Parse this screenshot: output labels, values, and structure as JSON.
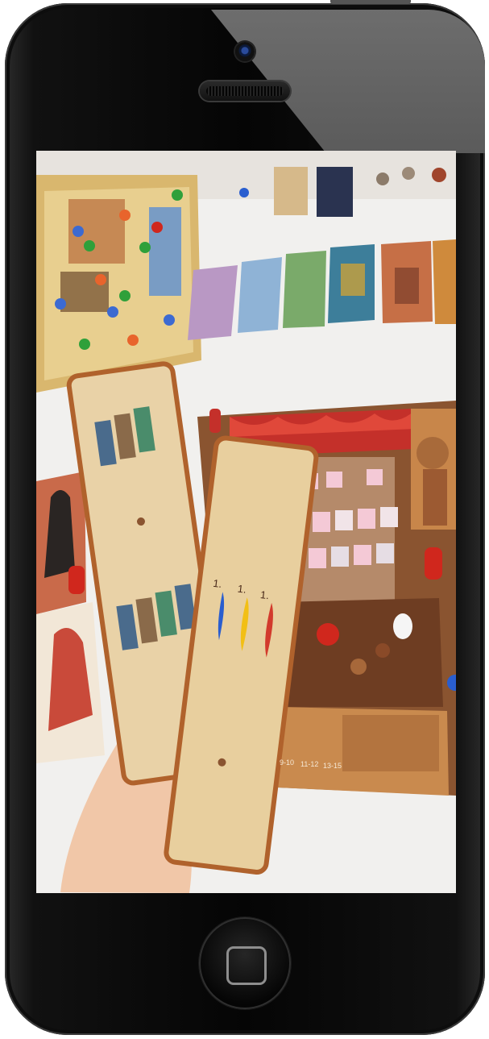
{
  "device": {
    "type": "smartphone",
    "icons": [
      "front-camera-icon",
      "earpiece-speaker-icon",
      "home-button-icon"
    ]
  },
  "photo": {
    "subject": "board game table",
    "colors": {
      "table": "#f1f0ee",
      "card": "#e9d2a7",
      "card_border": "#b0622c",
      "board_red": "#c4302a",
      "board_brown": "#8a5430",
      "token_red": "#d0271d",
      "quill_blue": "#2a5ecf",
      "quill_yellow": "#f2bf15",
      "quill_red": "#d23a2c"
    },
    "card_labels": [
      "1.",
      "1.",
      "1."
    ],
    "board_labels": [
      "9-10",
      "11-12",
      "13-15"
    ]
  }
}
